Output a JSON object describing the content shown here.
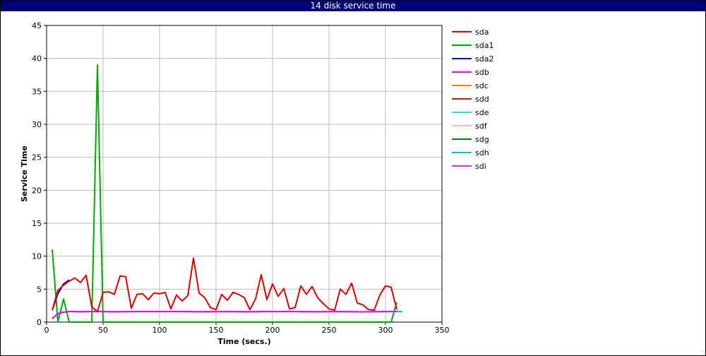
{
  "window": {
    "title": "14 disk service time"
  },
  "chart_data": {
    "type": "line",
    "title": "14 disk service time",
    "xlabel": "Time (secs.)",
    "ylabel": "Service Time",
    "xlim": [
      0,
      350
    ],
    "ylim": [
      0,
      45
    ],
    "xticks": [
      0,
      50,
      100,
      150,
      200,
      250,
      300,
      350
    ],
    "yticks": [
      0,
      5,
      10,
      15,
      20,
      25,
      30,
      35,
      40,
      45
    ],
    "grid": true,
    "legend_position": "right",
    "series": [
      {
        "name": "sda1",
        "color": "#00aa00",
        "x": [
          5,
          10,
          15,
          20,
          25,
          30,
          35,
          40,
          45,
          50,
          60,
          100,
          150,
          200,
          250,
          300,
          305,
          310
        ],
        "y": [
          11,
          0,
          3.5,
          0,
          0,
          0,
          0,
          0,
          39,
          0,
          0,
          0,
          0,
          0,
          0,
          0,
          0,
          3
        ]
      },
      {
        "name": "sdh",
        "color": "#00bbcc",
        "x": [
          5,
          10,
          15,
          20,
          50,
          100,
          150,
          200,
          250,
          280,
          300,
          310,
          315
        ],
        "y": [
          0.6,
          1.2,
          1.5,
          1.6,
          1.6,
          1.6,
          1.6,
          1.6,
          1.6,
          1.55,
          1.6,
          1.6,
          1.6
        ]
      },
      {
        "name": "sdb",
        "color": "#ee00ee",
        "x": [
          5,
          10,
          15,
          20,
          25,
          30,
          40,
          50,
          60,
          80,
          100,
          120,
          140,
          160,
          180,
          200,
          220,
          240,
          260,
          280,
          300,
          310
        ],
        "y": [
          0.5,
          1.3,
          1.5,
          1.6,
          1.6,
          1.55,
          1.6,
          1.6,
          1.55,
          1.6,
          1.6,
          1.6,
          1.55,
          1.6,
          1.55,
          1.6,
          1.6,
          1.55,
          1.6,
          1.55,
          1.6,
          1.6
        ]
      },
      {
        "name": "sda2",
        "color": "#0000cc",
        "x": [
          5,
          10,
          15,
          20
        ],
        "y": [
          1.8,
          4.3,
          5.8,
          6.4
        ]
      },
      {
        "name": "sda",
        "color": "#dd0000",
        "x": [
          5,
          10,
          15,
          20,
          25,
          30,
          35,
          40,
          45,
          50,
          55,
          60,
          65,
          70,
          75,
          80,
          85,
          90,
          95,
          100,
          105,
          110,
          115,
          120,
          125,
          130,
          135,
          140,
          145,
          150,
          155,
          160,
          165,
          170,
          175,
          180,
          185,
          190,
          195,
          200,
          205,
          210,
          215,
          220,
          225,
          230,
          235,
          240,
          245,
          250,
          255,
          260,
          265,
          270,
          275,
          280,
          285,
          290,
          295,
          300,
          305,
          310
        ],
        "y": [
          1.8,
          4.8,
          5.6,
          6.2,
          6.7,
          6.0,
          7.1,
          2.3,
          1.6,
          4.5,
          4.6,
          4.2,
          7.0,
          6.9,
          2.1,
          4.2,
          4.3,
          3.4,
          4.4,
          4.3,
          4.5,
          2.0,
          4.1,
          3.2,
          4.0,
          9.7,
          4.4,
          3.7,
          2.2,
          1.9,
          4.2,
          3.3,
          4.5,
          4.2,
          3.7,
          1.9,
          3.5,
          7.2,
          3.4,
          5.8,
          3.9,
          5.1,
          2.0,
          2.2,
          5.5,
          4.2,
          5.4,
          3.7,
          2.8,
          2.0,
          1.8,
          5.0,
          4.2,
          5.9,
          2.9,
          2.6,
          1.9,
          1.8,
          4.1,
          5.5,
          5.3,
          1.9
        ]
      }
    ],
    "legend": [
      {
        "name": "sda",
        "color": "#dd0000"
      },
      {
        "name": "sda1",
        "color": "#00aa00"
      },
      {
        "name": "sda2",
        "color": "#0000cc"
      },
      {
        "name": "sdb",
        "color": "#ee00ee"
      },
      {
        "name": "sdc",
        "color": "#ee8800"
      },
      {
        "name": "sdd",
        "color": "#aa2200"
      },
      {
        "name": "sde",
        "color": "#22dddd"
      },
      {
        "name": "sdf",
        "color": "#ffbbbb"
      },
      {
        "name": "sdg",
        "color": "#007700"
      },
      {
        "name": "sdh",
        "color": "#00bbcc"
      },
      {
        "name": "sdi",
        "color": "#bb44bb"
      }
    ]
  }
}
